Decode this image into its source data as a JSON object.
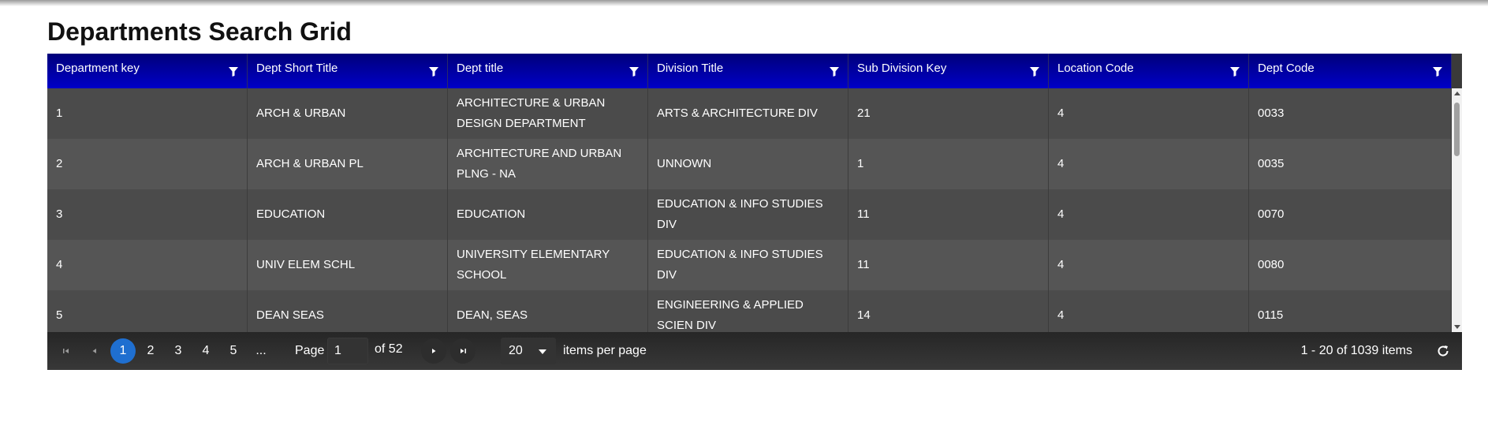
{
  "page": {
    "title": "Departments Search Grid"
  },
  "grid": {
    "columns": [
      {
        "label": "Department key"
      },
      {
        "label": "Dept Short Title"
      },
      {
        "label": "Dept title"
      },
      {
        "label": "Division Title"
      },
      {
        "label": "Sub Division Key"
      },
      {
        "label": "Location Code"
      },
      {
        "label": "Dept Code"
      }
    ],
    "rows": [
      [
        "1",
        "ARCH & URBAN",
        "ARCHITECTURE & URBAN DESIGN DEPARTMENT",
        "ARTS & ARCHITECTURE DIV",
        "21",
        "4",
        "0033"
      ],
      [
        "2",
        "ARCH & URBAN PL",
        "ARCHITECTURE AND URBAN PLNG - NA",
        "UNNOWN",
        "1",
        "4",
        "0035"
      ],
      [
        "3",
        "EDUCATION",
        "EDUCATION",
        "EDUCATION & INFO STUDIES DIV",
        "11",
        "4",
        "0070"
      ],
      [
        "4",
        "UNIV ELEM SCHL",
        "UNIVERSITY ELEMENTARY SCHOOL",
        "EDUCATION & INFO STUDIES DIV",
        "11",
        "4",
        "0080"
      ],
      [
        "5",
        "DEAN SEAS",
        "DEAN, SEAS",
        "ENGINEERING & APPLIED SCIEN DIV",
        "14",
        "4",
        "0115"
      ]
    ]
  },
  "pager": {
    "pages": [
      "1",
      "2",
      "3",
      "4",
      "5",
      "..."
    ],
    "current_page": "1",
    "page_label": "Page",
    "of_label": "of 52",
    "page_size": "20",
    "items_per_page_label": "items per page",
    "info": "1 - 20 of 1039 items"
  },
  "icons": {
    "filter": "filter-icon",
    "first": "first-page-icon",
    "prev": "previous-page-icon",
    "next": "next-page-icon",
    "last": "last-page-icon",
    "refresh": "refresh-icon"
  },
  "colors": {
    "header_gradient_top": "#00007a",
    "header_gradient_bottom": "#0000c8",
    "active_page": "#1f6fd0",
    "row_dark": "#4b4b4b",
    "row_light": "#555555"
  }
}
